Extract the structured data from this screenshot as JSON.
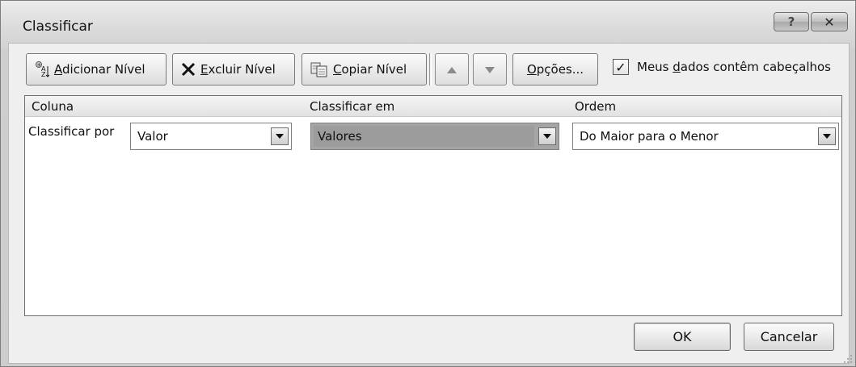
{
  "window": {
    "title": "Classificar"
  },
  "toolbar": {
    "add_level": {
      "icon": "add-level-icon",
      "prefix": "",
      "accel": "A",
      "suffix": "dicionar Nível"
    },
    "delete_level": {
      "icon": "delete-x-icon",
      "prefix": "",
      "accel": "E",
      "suffix": "xcluir Nível"
    },
    "copy_level": {
      "icon": "copy-level-icon",
      "prefix": "",
      "accel": "C",
      "suffix": "opiar Nível"
    },
    "move_up": {
      "icon": "arrow-up-icon"
    },
    "move_down": {
      "icon": "arrow-down-icon"
    },
    "options": {
      "prefix": "",
      "accel": "O",
      "suffix": "pções..."
    },
    "headers_checkbox": {
      "checked": true,
      "prefix": "Meus ",
      "accel": "d",
      "suffix": "ados contêm cabeçalhos"
    }
  },
  "grid": {
    "headers": {
      "column": "Coluna",
      "sort_on": "Classificar em",
      "order": "Ordem"
    },
    "rows": [
      {
        "label": "Classificar por",
        "column_value": "Valor",
        "sort_on_value": "Valores",
        "order_value": "Do Maior para o Menor"
      }
    ]
  },
  "footer": {
    "ok": "OK",
    "cancel": "Cancelar"
  }
}
